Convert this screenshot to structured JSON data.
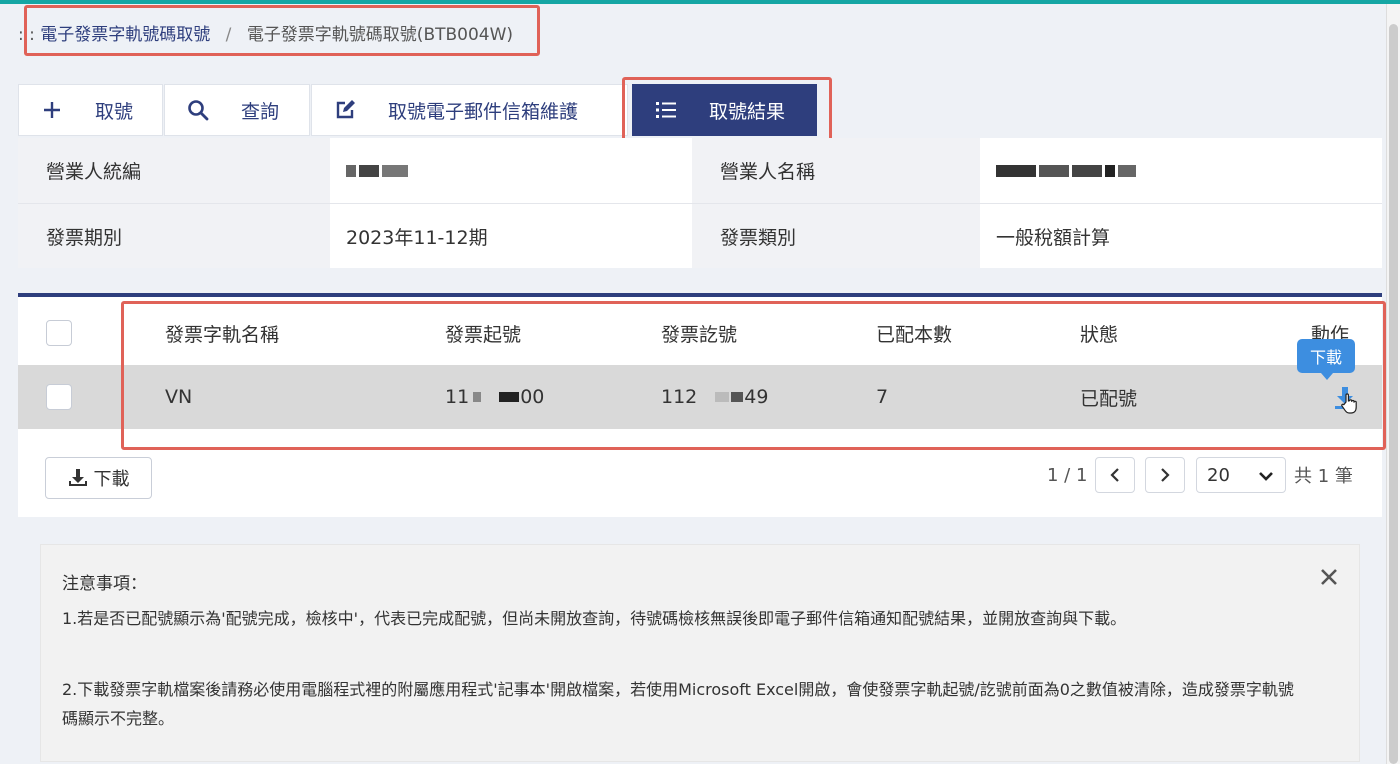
{
  "breadcrumb": {
    "prefix": ": :",
    "parent": "電子發票字軌號碼取號",
    "separator": "/",
    "current": "電子發票字軌號碼取號(BTB004W)"
  },
  "tabs": [
    {
      "label": "取號",
      "icon": "plus-icon"
    },
    {
      "label": "查詢",
      "icon": "search-icon"
    },
    {
      "label": "取號電子郵件信箱維護",
      "icon": "edit-icon"
    },
    {
      "label": "取號結果",
      "icon": "list-icon",
      "active": true
    }
  ],
  "info": {
    "tax_id_label": "營業人統編",
    "tax_id_value": "",
    "name_label": "營業人名稱",
    "name_value": "",
    "period_label": "發票期別",
    "period_value": "2023年11-12期",
    "type_label": "發票類別",
    "type_value": "一般稅額計算"
  },
  "table": {
    "columns": [
      "發票字軌名稱",
      "發票起號",
      "發票訖號",
      "已配本數",
      "狀態",
      "動作"
    ],
    "rows": [
      {
        "track_name": "VN",
        "start_prefix": "11",
        "start_suffix": "00",
        "end_prefix": "112",
        "end_suffix": "49",
        "count": "7",
        "status": "已配號"
      }
    ],
    "action_tooltip": "下載"
  },
  "footer": {
    "download_label": "下載",
    "page_info": "1 / 1",
    "page_size": "20",
    "total": "共 1 筆"
  },
  "notice": {
    "title": "注意事項：",
    "items": [
      "1.若是否已配號顯示為'配號完成，檢核中'，代表已完成配號，但尚未開放查詢，待號碼檢核無誤後即電子郵件信箱通知配號結果，並開放查詢與下載。",
      "2.下載發票字軌檔案後請務必使用電腦程式裡的附屬應用程式'記事本'開啟檔案，若使用Microsoft Excel開啟，會使發票字軌起號/訖號前面為0之數值被清除，造成發票字軌號碼顯示不完整。"
    ]
  },
  "colors": {
    "primary": "#2e3e7d",
    "highlight": "#e06258",
    "tooltip": "#3d8ee0",
    "teal_bar": "#15a6a4"
  }
}
